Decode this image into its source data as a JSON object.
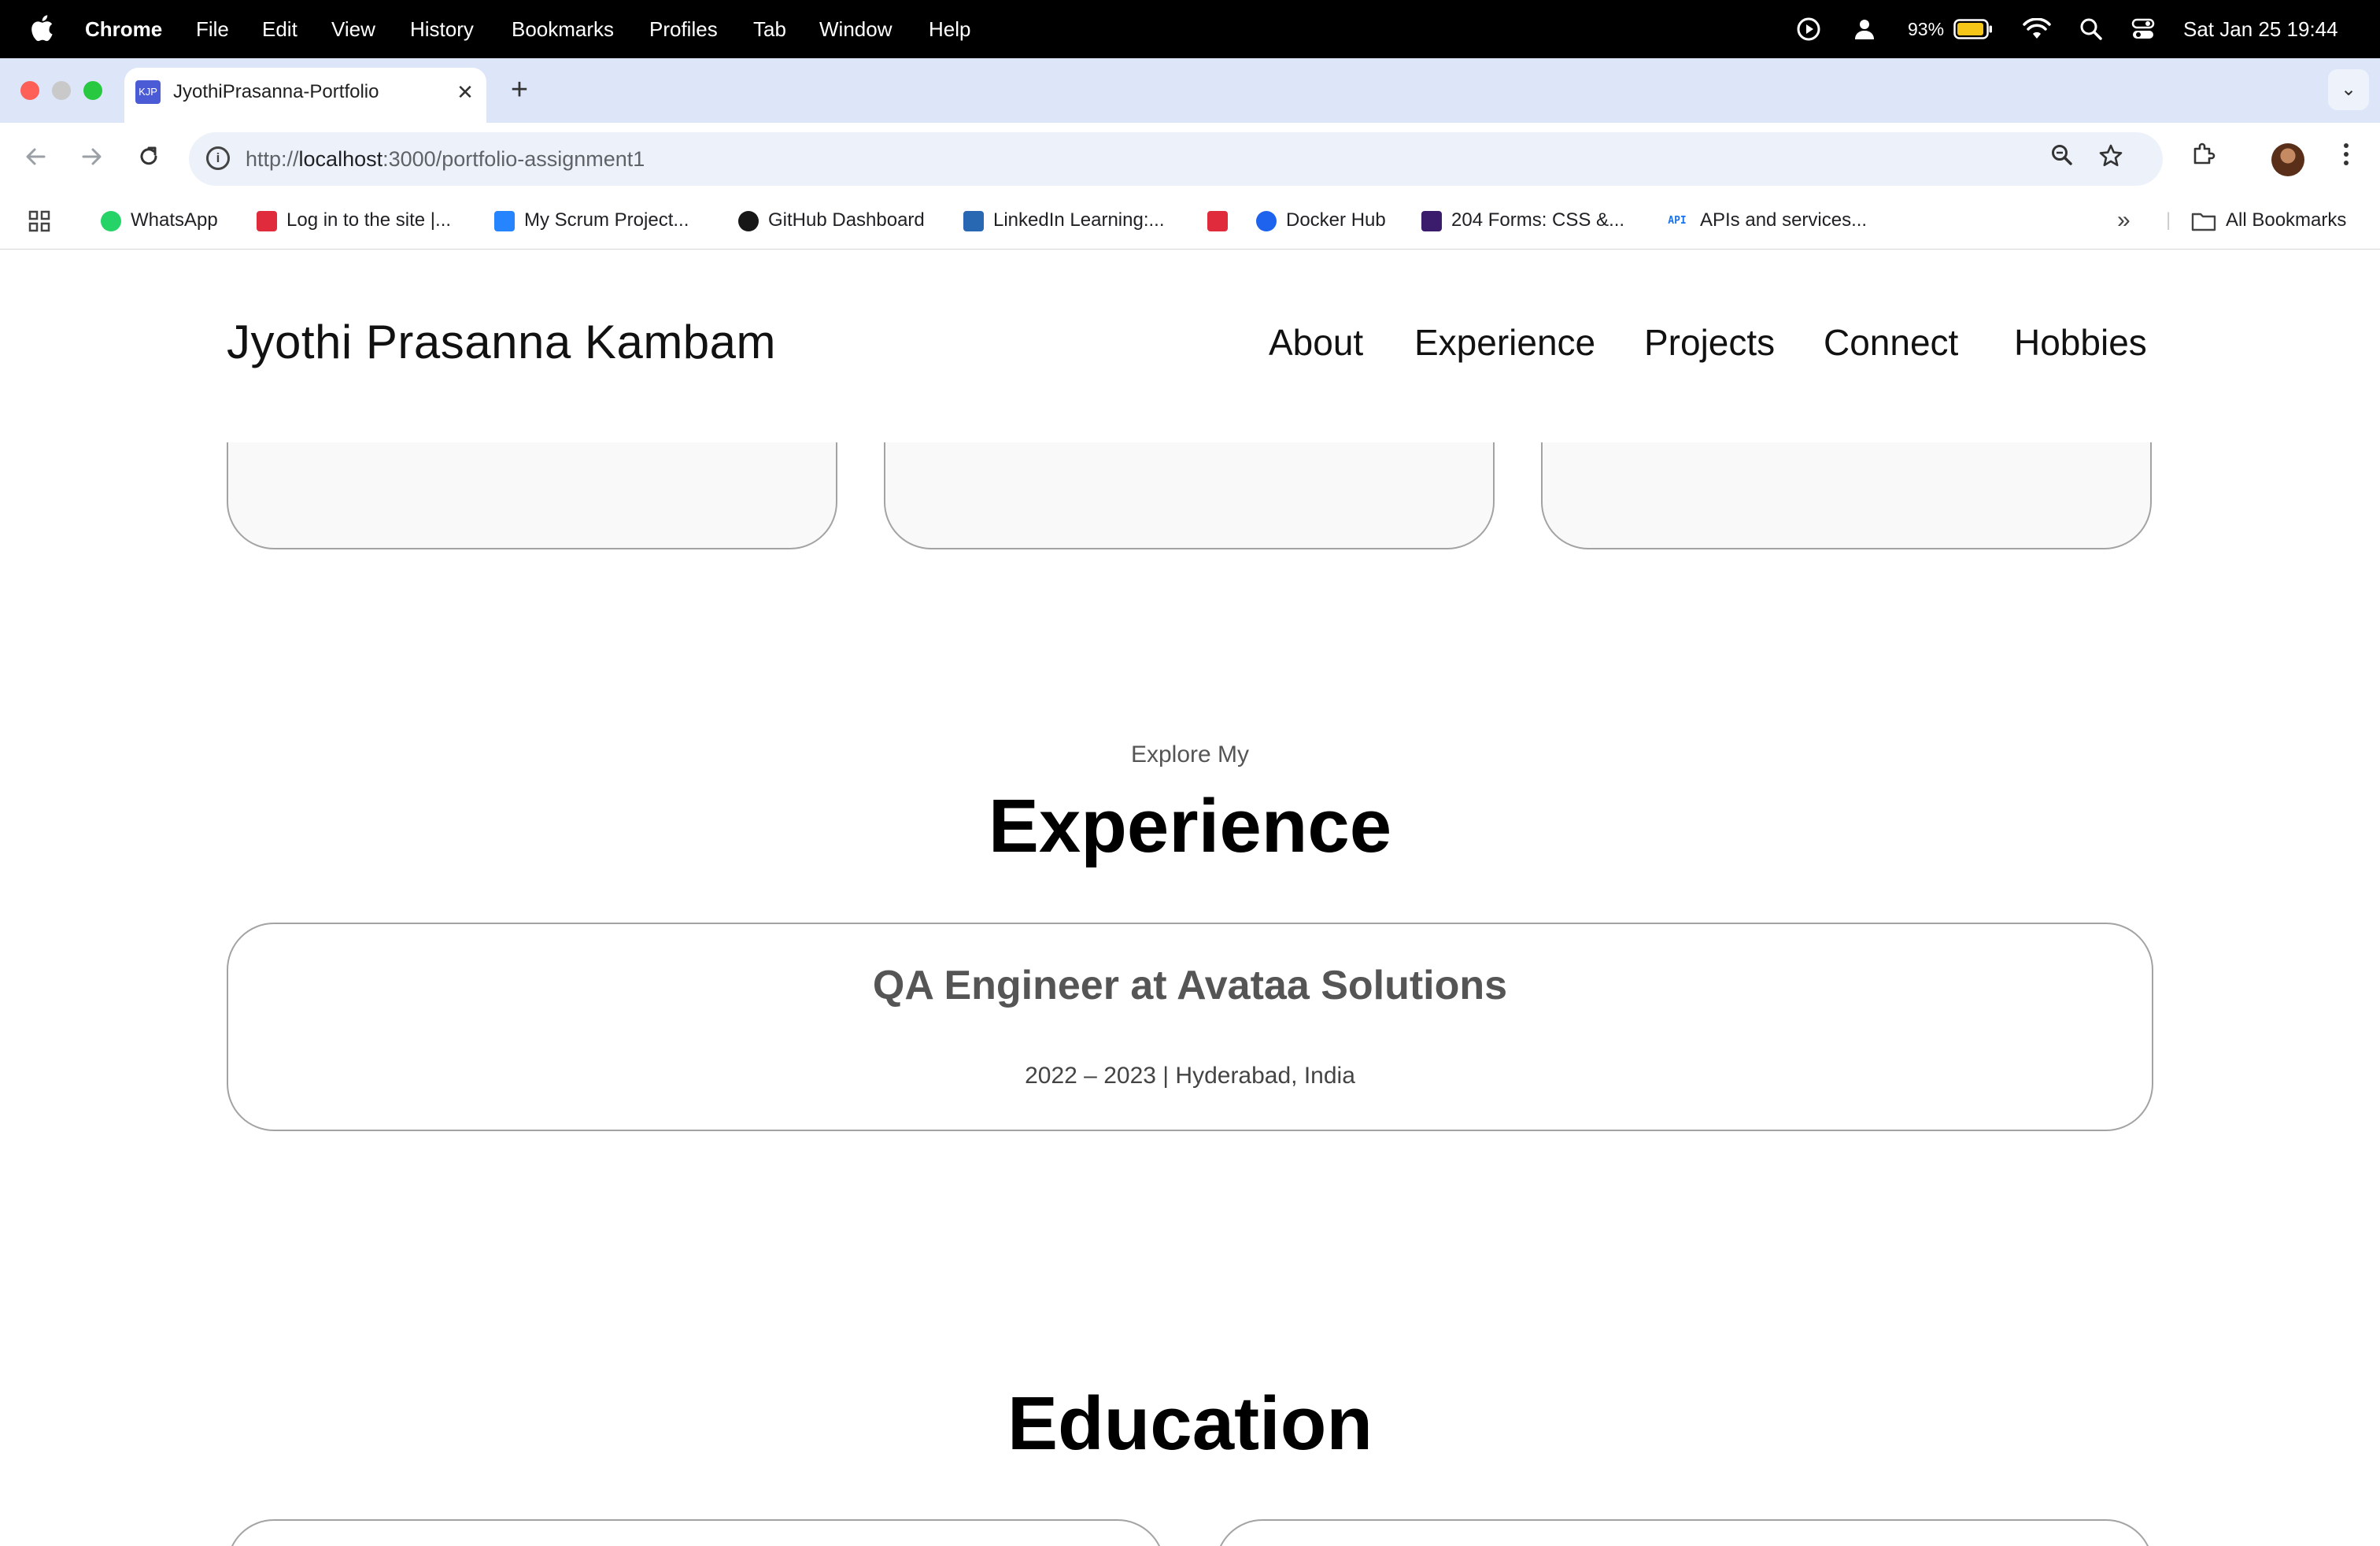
{
  "menubar": {
    "apple": "",
    "app": "Chrome",
    "items": [
      "File",
      "Edit",
      "View",
      "History",
      "Bookmarks",
      "Profiles",
      "Tab",
      "Window",
      "Help"
    ],
    "battery": "93%",
    "datetime": "Sat Jan 25  19:44"
  },
  "browser": {
    "tab": {
      "favicon": "KJP",
      "title": "JyothiPrasanna-Portfolio"
    },
    "url": {
      "scheme": "http://",
      "host": "localhost",
      "rest": ":3000/portfolio-assignment1"
    },
    "bookmarks": [
      {
        "label": "WhatsApp",
        "icon": "whatsapp-icon",
        "color": "#25d366"
      },
      {
        "label": "Log in to the site |...",
        "icon": "site-icon",
        "color": "#e02b3c"
      },
      {
        "label": "My Scrum Project...",
        "icon": "jira-icon",
        "color": "#2684ff"
      },
      {
        "label": "GitHub Dashboard",
        "icon": "github-icon",
        "color": "#181717"
      },
      {
        "label": "LinkedIn Learning:...",
        "icon": "linkedin-learning-icon",
        "color": "#2867b2"
      },
      {
        "label": "",
        "icon": "site-icon",
        "color": "#e02b3c"
      },
      {
        "label": "Docker Hub",
        "icon": "docker-icon",
        "color": "#1d63ed"
      },
      {
        "label": "204 Forms: CSS &...",
        "icon": "ui-icon",
        "color": "#3b1b6b"
      },
      {
        "label": "APIs and services...",
        "icon": "api-icon",
        "color": "#1a73e8"
      }
    ],
    "all_bookmarks": "All Bookmarks"
  },
  "site": {
    "name": "Jyothi Prasanna Kambam",
    "nav": [
      "About",
      "Experience",
      "Projects",
      "Connect",
      "Hobbies"
    ],
    "experience": {
      "subtitle": "Explore My",
      "title": "Experience",
      "items": [
        {
          "role": "QA Engineer at Avataa Solutions",
          "meta": "2022 – 2023 | Hyderabad, India"
        }
      ]
    },
    "education": {
      "title": "Education"
    }
  }
}
